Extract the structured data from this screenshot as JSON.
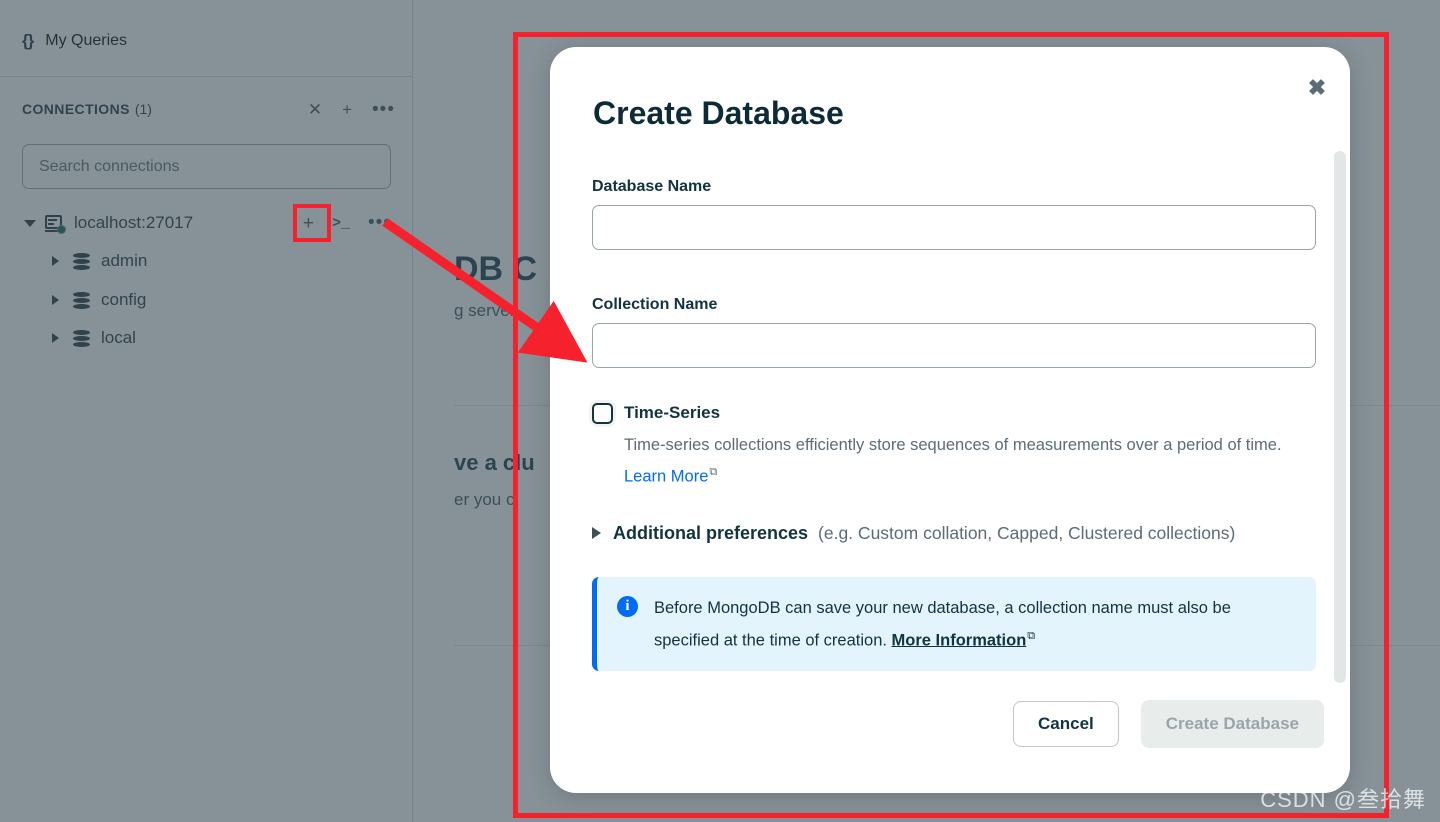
{
  "sidebar": {
    "my_queries": {
      "label": "My Queries",
      "icon": "braces-icon"
    },
    "connections": {
      "title": "CONNECTIONS",
      "count": "(1)",
      "actions": [
        {
          "name": "collapse-all-icon",
          "glyph": "✕"
        },
        {
          "name": "add-connection-icon",
          "glyph": "+"
        },
        {
          "name": "more-options-icon",
          "glyph": "•••"
        }
      ],
      "search_placeholder": "Search connections",
      "search_value": "",
      "connection": {
        "label": "localhost:27017",
        "status": "connected",
        "status_color": "#00684a",
        "actions": [
          {
            "name": "create-database-icon",
            "glyph": "+"
          },
          {
            "name": "open-shell-icon",
            "glyph": ">_"
          },
          {
            "name": "connection-more-icon",
            "glyph": "•••"
          }
        ]
      },
      "databases": [
        {
          "label": "admin"
        },
        {
          "label": "config"
        },
        {
          "label": "local"
        }
      ]
    }
  },
  "background": {
    "heading": "DB C",
    "subtext": "g server",
    "card_heading": "ve a clu",
    "card_text": "er you c"
  },
  "modal": {
    "title": "Create Database",
    "close_label": "✖",
    "database_name": {
      "label": "Database Name",
      "value": "",
      "placeholder": ""
    },
    "collection_name": {
      "label": "Collection Name",
      "value": "",
      "placeholder": ""
    },
    "time_series": {
      "label": "Time-Series",
      "checked": false,
      "description": "Time-series collections efficiently store sequences of measurements over a period of time. ",
      "link_text": "Learn More",
      "link_icon": "⧉"
    },
    "additional_preferences": {
      "strong": "Additional preferences",
      "muted": "(e.g. Custom collation, Capped, Clustered collections)",
      "expanded": false
    },
    "banner": {
      "icon": "info-icon",
      "text": "Before MongoDB can save your new database, a collection name must also be specified at the time of creation. ",
      "link_text": "More Information",
      "link_icon": "⧉",
      "accent_color": "#016bf8",
      "background_color": "#e3f4fc"
    },
    "buttons": {
      "cancel": "Cancel",
      "create": "Create Database",
      "create_disabled": true
    }
  },
  "annotations": {
    "highlight_color": "#f5222d",
    "watermark": "CSDN @叁拾舞"
  }
}
